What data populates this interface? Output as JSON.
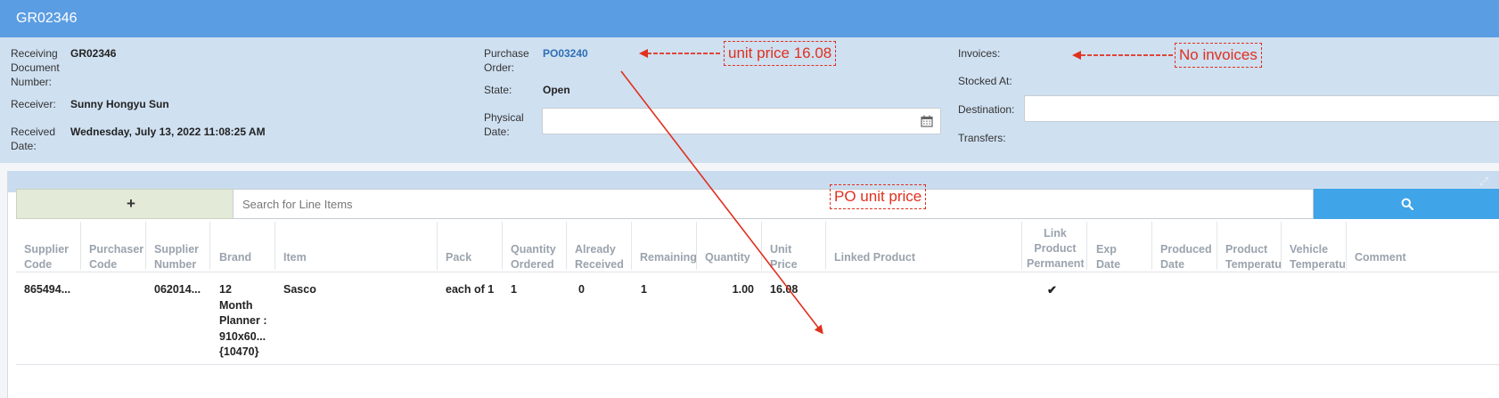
{
  "window": {
    "title": "GR02346"
  },
  "info": {
    "receiving_doc_label": "Receiving Document Number:",
    "receiving_doc_value": "GR02346",
    "receiver_label": "Receiver:",
    "receiver_value": "Sunny Hongyu Sun",
    "received_date_label": "Received Date:",
    "received_date_value": "Wednesday, July 13, 2022 11:08:25 AM",
    "purchase_order_label": "Purchase Order:",
    "purchase_order_value": "PO03240",
    "state_label": "State:",
    "state_value": "Open",
    "physical_date_label": "Physical Date:",
    "physical_date_value": "",
    "invoices_label": "Invoices:",
    "stocked_at_label": "Stocked At:",
    "destination_label": "Destination:",
    "destination_value": "",
    "transfers_label": "Transfers:"
  },
  "toolbar": {
    "add_label": "+",
    "search_placeholder": "Search for Line Items"
  },
  "table": {
    "headers": {
      "supplier_code": [
        "Supplier",
        "Code"
      ],
      "purchaser_code": [
        "Purchaser",
        "Code"
      ],
      "supplier_number": [
        "Supplier",
        "Number"
      ],
      "brand": "Brand",
      "item": "Item",
      "pack": "Pack",
      "qty_ordered": [
        "Quantity",
        "Ordered"
      ],
      "already_received": [
        "Already",
        "Received"
      ],
      "remaining": "Remaining",
      "quantity": "Quantity",
      "unit_price": [
        "Unit",
        "Price"
      ],
      "linked_product": "Linked Product",
      "link_product_permanent": [
        "Link",
        "Product",
        "Permanent"
      ],
      "exp_date": [
        "Exp",
        "Date"
      ],
      "produced_date": [
        "Produced",
        "Date"
      ],
      "product_temperature": [
        "Product",
        "Temperature"
      ],
      "vehicle_temperature": [
        "Vehicle",
        "Temperature"
      ],
      "comment": "Comment"
    },
    "rows": [
      {
        "supplier_code": "865494...",
        "purchaser_code": "",
        "supplier_number": "062014...",
        "brand": [
          "12",
          "Month",
          "Planner :",
          "910x60...",
          "{10470}"
        ],
        "item": "Sasco",
        "pack": "each of 1",
        "qty_ordered": "1",
        "already_received": "0",
        "remaining": "1",
        "quantity": "1.00",
        "unit_price": "16.08",
        "link_product_permanent": "✔"
      }
    ]
  },
  "annotations": {
    "po_note": "unit price 16.08",
    "invoice_note": "No invoices",
    "price_note": "PO unit price"
  },
  "colors": {
    "titlebar": "#5b9de3",
    "info_bg": "#cfe0f1",
    "search_button": "#3fa4e8",
    "add_button": "#e3ead8",
    "annotation": "#e0301e",
    "link": "#2f6fb4"
  }
}
